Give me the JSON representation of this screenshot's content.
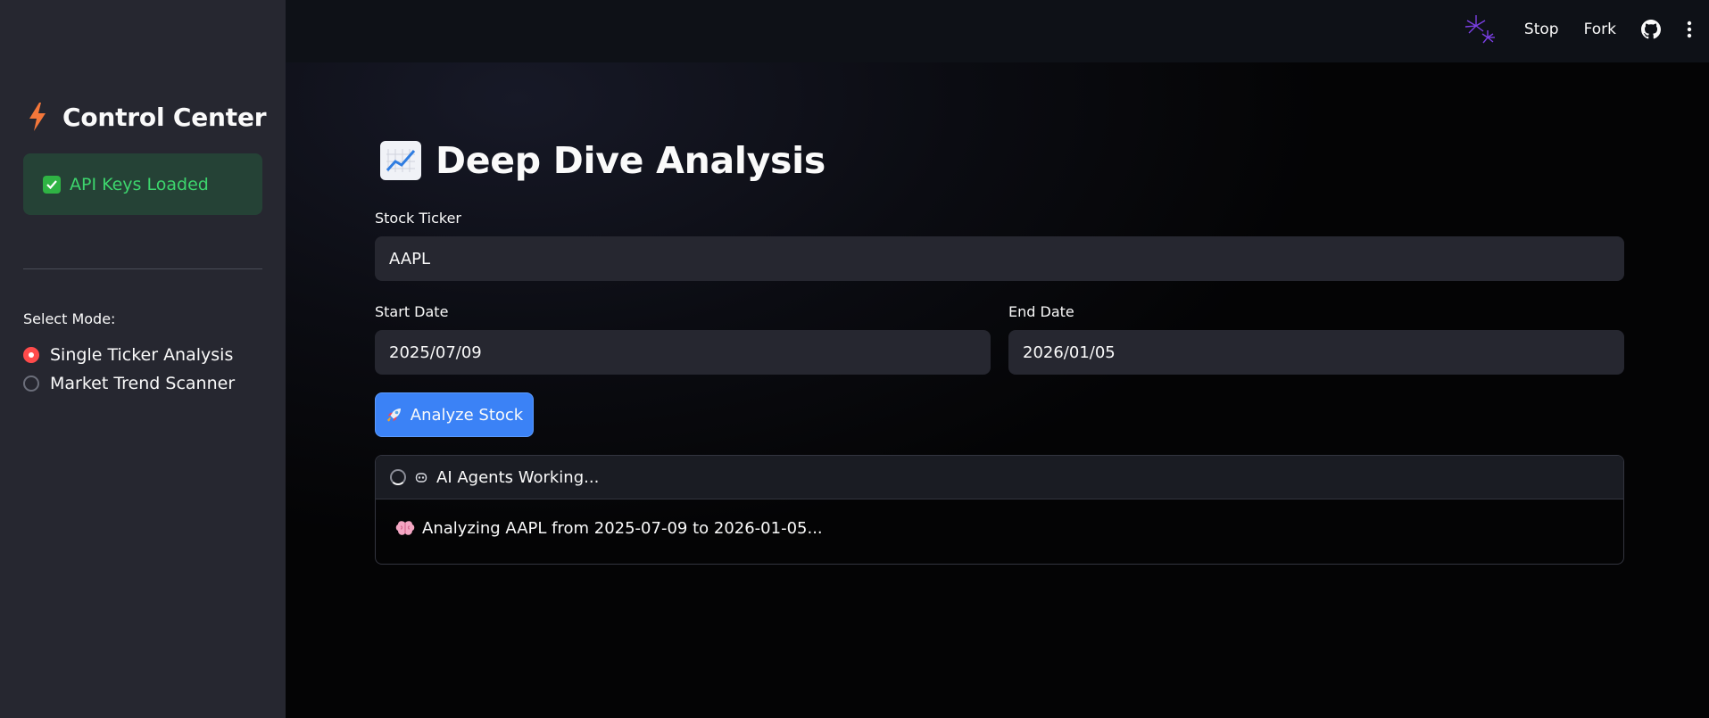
{
  "sidebar": {
    "title": "Control Center",
    "title_icon": "lightning-bolt-icon",
    "status_badge": "API Keys Loaded",
    "status_icon": "check-box-icon",
    "mode_label": "Select Mode:",
    "modes": [
      {
        "label": "Single Ticker Analysis",
        "selected": true
      },
      {
        "label": "Market Trend Scanner",
        "selected": false
      }
    ]
  },
  "header": {
    "stop_label": "Stop",
    "fork_label": "Fork",
    "icons": [
      "fireworks-icon",
      "github-icon",
      "kebab-menu-icon"
    ]
  },
  "main": {
    "title": "Deep Dive Analysis",
    "title_icon": "chart-increasing-icon",
    "ticker": {
      "label": "Stock Ticker",
      "value": "AAPL"
    },
    "start_date": {
      "label": "Start Date",
      "value": "2025/07/09"
    },
    "end_date": {
      "label": "End Date",
      "value": "2026/01/05"
    },
    "analyze_button": "Analyze Stock",
    "analyze_icon": "rocket-icon",
    "status": {
      "header": "AI Agents Working...",
      "message": "Analyzing AAPL from 2025-07-09 to 2026-01-05..."
    }
  },
  "colors": {
    "accent_primary": "#ff4b4b",
    "button_blue": "#3b82f6",
    "success_green": "#3dd56d",
    "sidebar_bg": "#262730",
    "app_bg": "#0e1117"
  }
}
